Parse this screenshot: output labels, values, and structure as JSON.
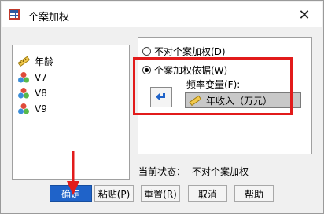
{
  "window": {
    "title": "个案加权",
    "close_glyph": "✕"
  },
  "variables": [
    {
      "label": "年龄",
      "icon": "ruler-icon"
    },
    {
      "label": "V7",
      "icon": "nominal-balls-icon"
    },
    {
      "label": "V8",
      "icon": "nominal-balls-icon"
    },
    {
      "label": "V9",
      "icon": "nominal-balls-icon"
    }
  ],
  "options": {
    "do_not_weight": "不对个案加权(D)",
    "weight_by": "个案加权依据(W)",
    "selected": "weight_by"
  },
  "frequency": {
    "label": "频率变量(F):",
    "value": "年收入（万元）"
  },
  "status": {
    "label": "当前状态：",
    "value": "不对个案加权"
  },
  "buttons": {
    "ok": "确定",
    "paste": "粘贴(P)",
    "reset": "重置(R)",
    "cancel": "取消",
    "help": "帮助"
  },
  "colors": {
    "accent": "#1f63c9",
    "highlight": "#e21b1b"
  }
}
